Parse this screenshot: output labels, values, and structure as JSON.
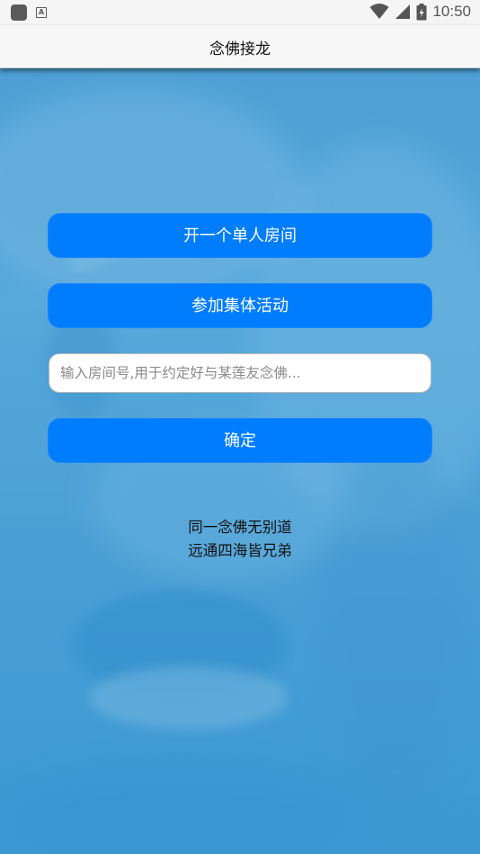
{
  "status_bar": {
    "time": "10:50",
    "icons": [
      "app-icon",
      "keyboard-a-icon",
      "wifi-icon",
      "signal-icon",
      "battery-icon"
    ]
  },
  "header": {
    "title": "念佛接龙"
  },
  "main": {
    "single_room_button": "开一个单人房间",
    "group_activity_button": "参加集体活动",
    "room_input": {
      "value": "",
      "placeholder": "输入房间号,用于约定好与某莲友念佛..."
    },
    "confirm_button": "确定",
    "verse_line_1": "同一念佛无别道",
    "verse_line_2": "远通四海皆兄弟"
  },
  "colors": {
    "primary_button": "#007dfd",
    "background": "#4aa0d6",
    "title_bar": "#f7f7f7"
  }
}
